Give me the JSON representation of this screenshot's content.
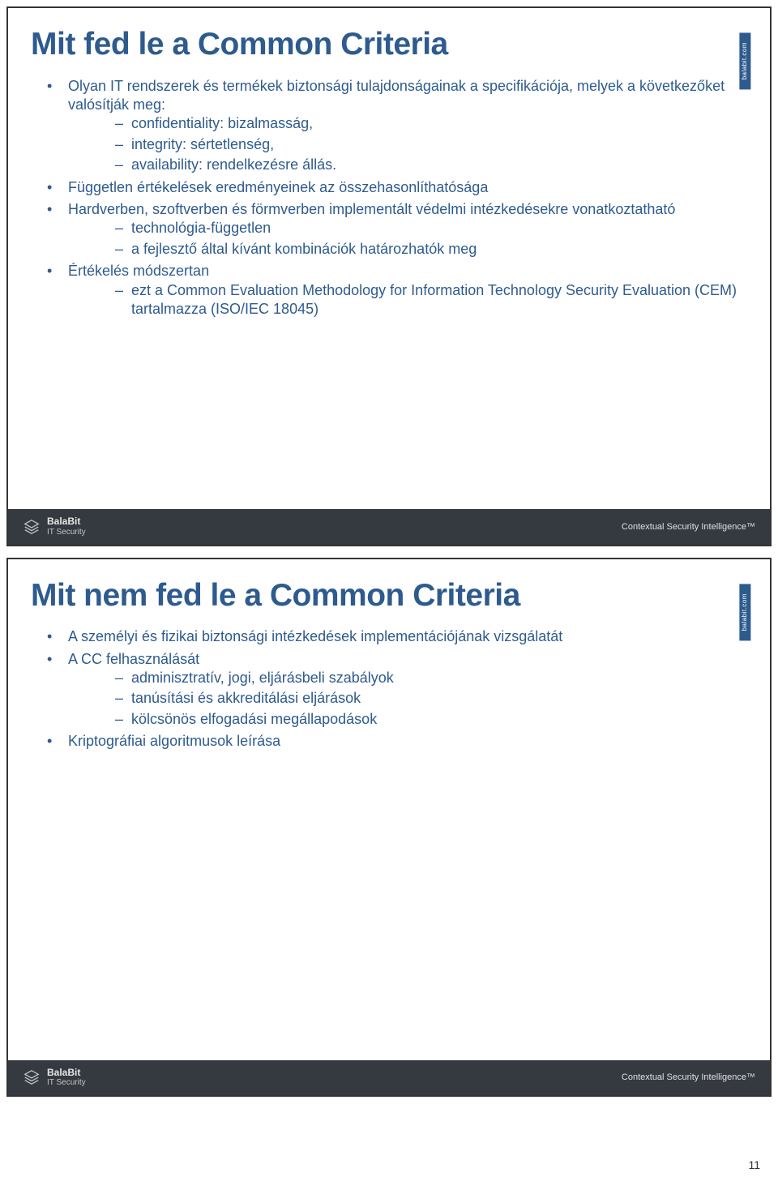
{
  "page_number": "11",
  "brand": {
    "name": "BalaBit",
    "sub": "IT Security",
    "tagline": "Contextual Security Intelligence™",
    "side": "balabit.com"
  },
  "slides": [
    {
      "title": "Mit fed le a Common Criteria",
      "bullets": [
        {
          "t": "Olyan IT rendszerek és termékek biztonsági tulajdonságainak a specifikációja, melyek a következőket valósítják meg:",
          "sub": [
            {
              "t": "confidentiality: bizalmasság,"
            },
            {
              "t": "integrity: sértetlenség,"
            },
            {
              "t": "availability: rendelkezésre állás."
            }
          ]
        },
        {
          "t": "Független értékelések eredményeinek az összehasonlíthatósága"
        },
        {
          "t": "Hardverben, szoftverben és förmverben implementált védelmi intézkedésekre vonatkoztatható",
          "sub": [
            {
              "t": " technológia-független"
            },
            {
              "t": "a fejlesztő által kívánt kombinációk határozhatók meg"
            }
          ]
        },
        {
          "t": "Értékelés módszertan",
          "sub": [
            {
              "t": "ezt a Common Evaluation Methodology for Information Technology Security Evaluation (CEM) tartalmazza (ISO/IEC 18045)"
            }
          ]
        }
      ]
    },
    {
      "title": "Mit nem fed le a Common Criteria",
      "bullets": [
        {
          "t": "A személyi és fizikai biztonsági intézkedések implementációjának vizsgálatát"
        },
        {
          "t": "A CC felhasználását",
          "sub": [
            {
              "t": "adminisztratív, jogi, eljárásbeli szabályok"
            },
            {
              "t": "tanúsítási és akkreditálási eljárások"
            },
            {
              "t": "kölcsönös elfogadási megállapodások"
            }
          ]
        },
        {
          "t": "Kriptográfiai algoritmusok leírása"
        }
      ]
    }
  ]
}
